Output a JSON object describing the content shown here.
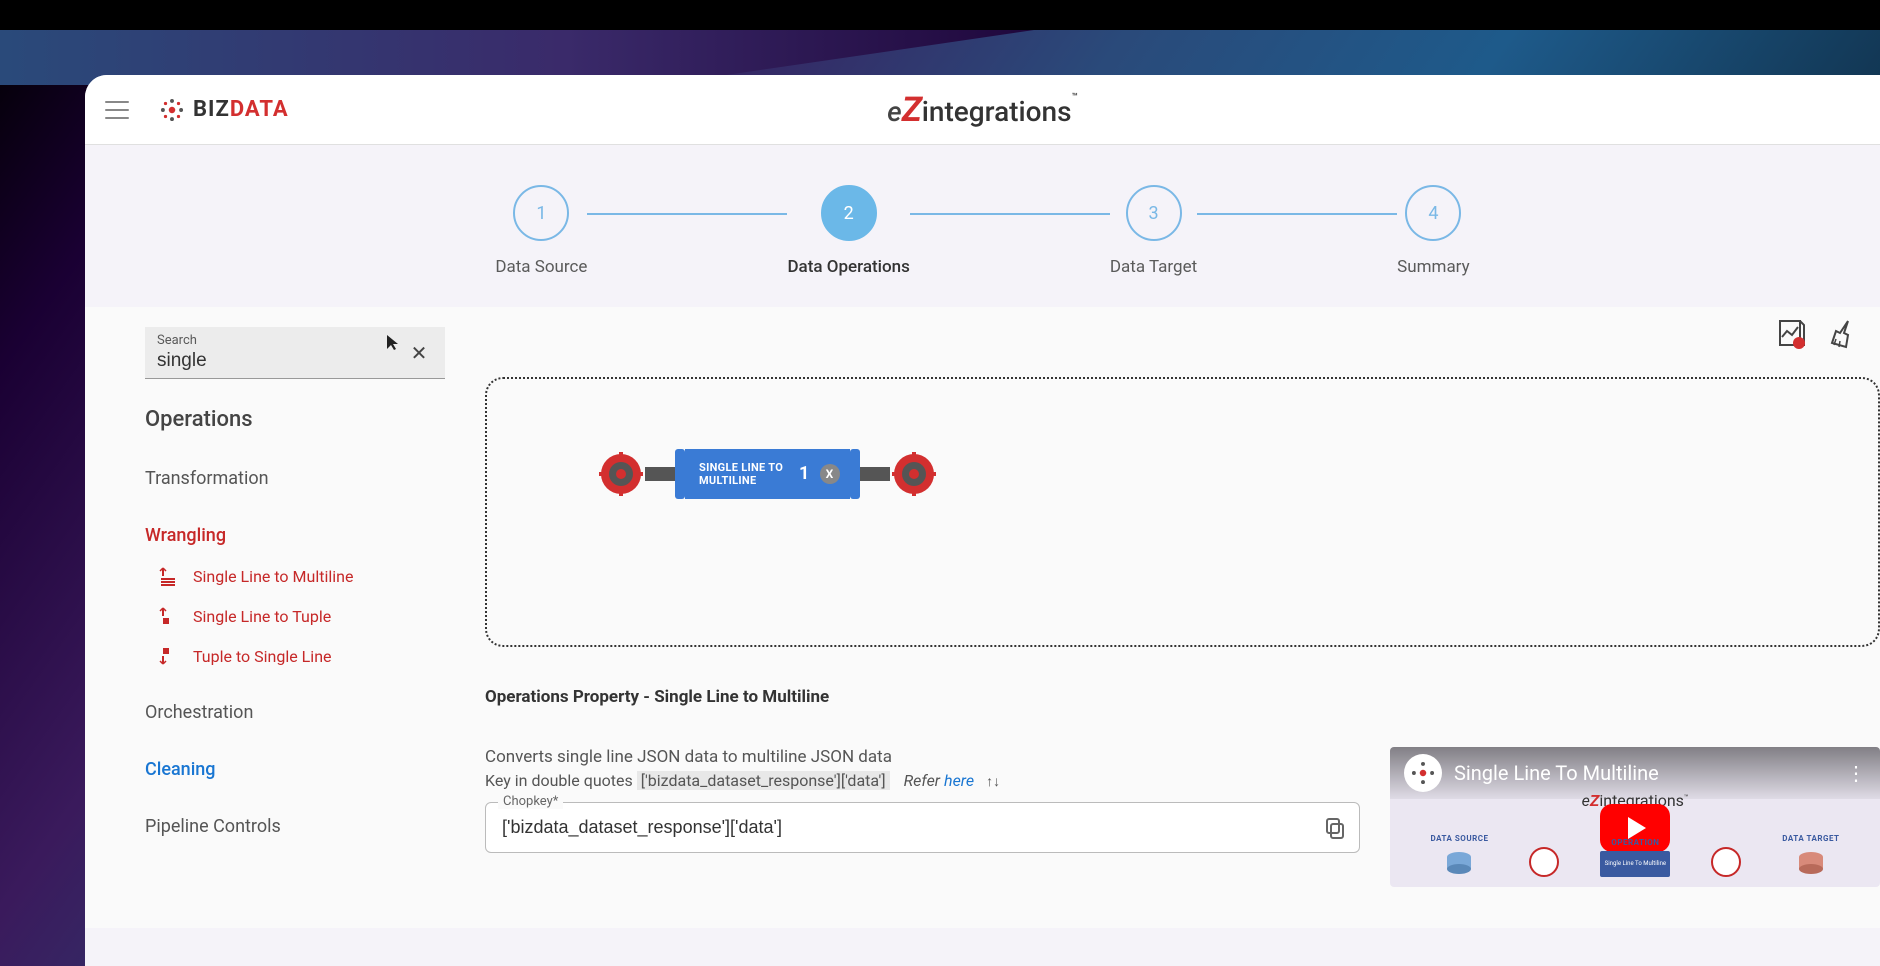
{
  "header": {
    "brand_biz": "BIZ",
    "brand_data": "DATA",
    "product": "integrations"
  },
  "stepper": {
    "steps": [
      {
        "num": "1",
        "label": "Data Source"
      },
      {
        "num": "2",
        "label": "Data Operations"
      },
      {
        "num": "3",
        "label": "Data Target"
      },
      {
        "num": "4",
        "label": "Summary"
      }
    ],
    "active_index": 1
  },
  "sidebar": {
    "search_label": "Search",
    "search_value": "single",
    "operations_title": "Operations",
    "categories": {
      "transformation": "Transformation",
      "wrangling": "Wrangling",
      "orchestration": "Orchestration",
      "cleaning": "Cleaning",
      "pipeline_controls": "Pipeline Controls"
    },
    "wrangling_ops": [
      "Single Line to Multiline",
      "Single Line to Tuple",
      "Tuple to Single Line"
    ]
  },
  "canvas": {
    "block_label": "SINGLE LINE TO MULTILINE",
    "block_index": "1",
    "block_close": "X"
  },
  "properties": {
    "title": "Operations Property - Single Line to Multiline",
    "desc1": "Converts single line JSON data to multiline JSON data",
    "desc2_prefix": "Key in double quotes ",
    "desc2_highlight": "['bizdata_dataset_response']['data']",
    "refer": "Refer",
    "here": "here",
    "chopkey_label": "Chopkey*",
    "chopkey_value": "['bizdata_dataset_response']['data']"
  },
  "video": {
    "title": "Single Line To Multiline",
    "inner_brand": "integrations",
    "labels": {
      "source": "DATA SOURCE",
      "operation": "OPERATION",
      "op_text": "Single Line To Multiline",
      "target": "DATA TARGET"
    }
  }
}
